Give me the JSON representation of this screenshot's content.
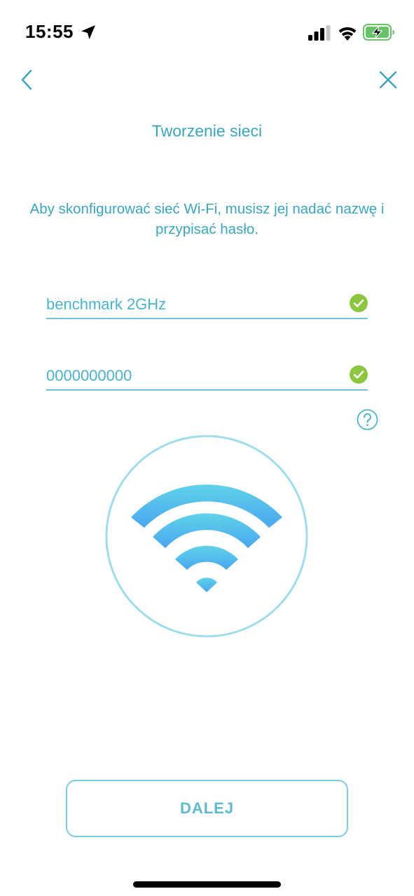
{
  "status_bar": {
    "time": "15:55",
    "icons": [
      "location-arrow-icon",
      "cellular-signal-icon",
      "wifi-icon",
      "battery-charging-icon"
    ]
  },
  "nav": {
    "back_icon": "chevron-left-icon",
    "close_icon": "close-icon"
  },
  "page": {
    "title": "Tworzenie sieci",
    "description": "Aby skonfigurować sieć Wi-Fi, musisz jej nadać nazwę i przypisać hasło."
  },
  "form": {
    "ssid_value": "benchmark 2GHz",
    "password_value": "0000000000",
    "valid_icon": "check-circle-icon"
  },
  "help_icon": "question-circle-icon",
  "illustration": "wifi-icon",
  "actions": {
    "next_label": "DALEJ"
  },
  "colors": {
    "accent": "#3aa5bf",
    "input_text": "#4ab4cc",
    "valid_green": "#8cc63f",
    "wifi_gradient_top": "#5fd3e8",
    "wifi_gradient_bottom": "#4aa6f0",
    "battery_green": "#65c466"
  }
}
